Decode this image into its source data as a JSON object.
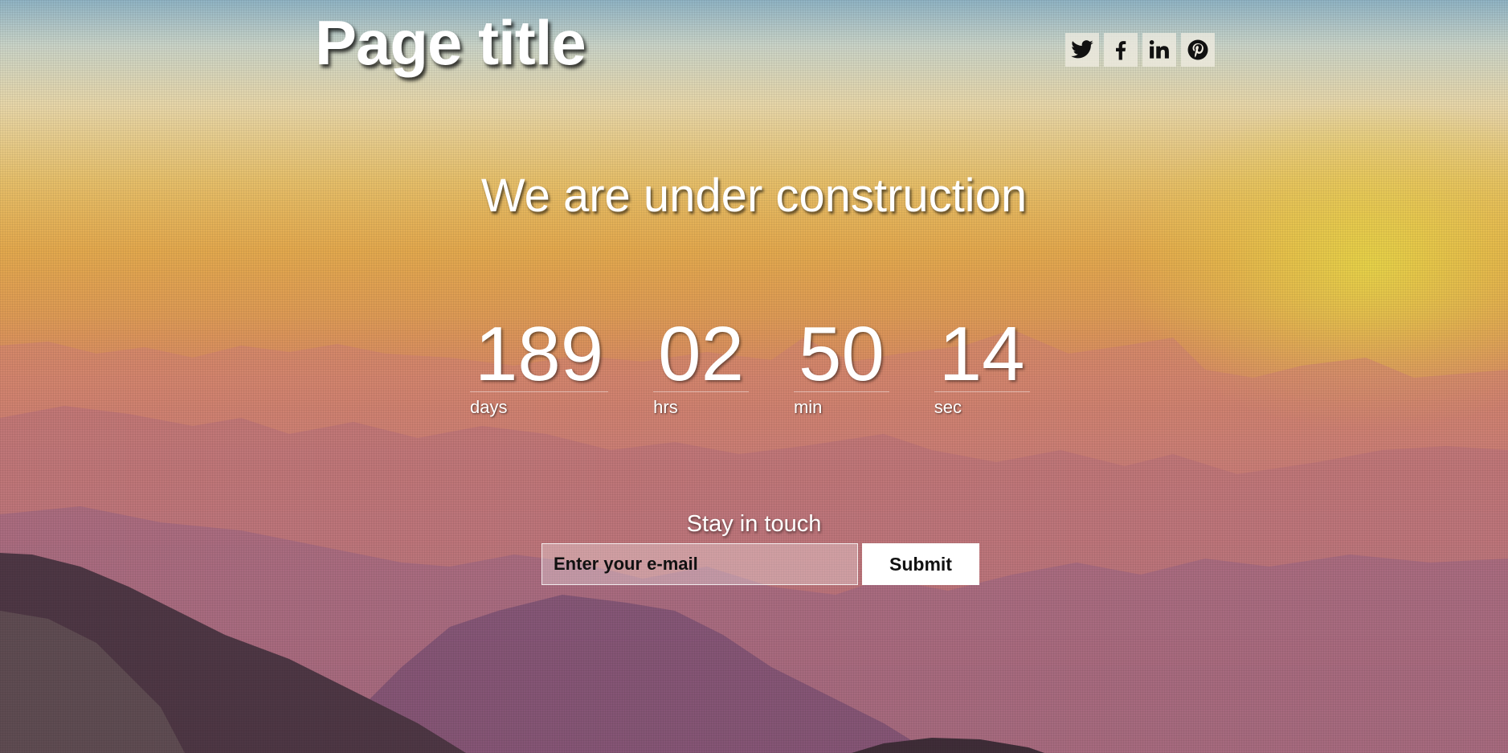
{
  "header": {
    "title": "Page title"
  },
  "social": [
    {
      "name": "twitter",
      "icon": "twitter-icon"
    },
    {
      "name": "facebook",
      "icon": "facebook-icon"
    },
    {
      "name": "linkedin",
      "icon": "linkedin-icon"
    },
    {
      "name": "pinterest",
      "icon": "pinterest-icon"
    }
  ],
  "main": {
    "headline": "We are under construction"
  },
  "countdown": [
    {
      "value": "189",
      "label": "days"
    },
    {
      "value": "02",
      "label": "hrs"
    },
    {
      "value": "50",
      "label": "min"
    },
    {
      "value": "14",
      "label": "sec"
    }
  ],
  "subscribe": {
    "heading": "Stay in touch",
    "email_placeholder": "Enter your e-mail",
    "submit_label": "Submit"
  },
  "colors": {
    "text": "#ffffff",
    "button_bg": "#ffffff",
    "button_text": "#111111",
    "sky_top": "#8fb3c4",
    "sky_orange": "#e3a94e",
    "mountain_pink": "#b47685"
  }
}
